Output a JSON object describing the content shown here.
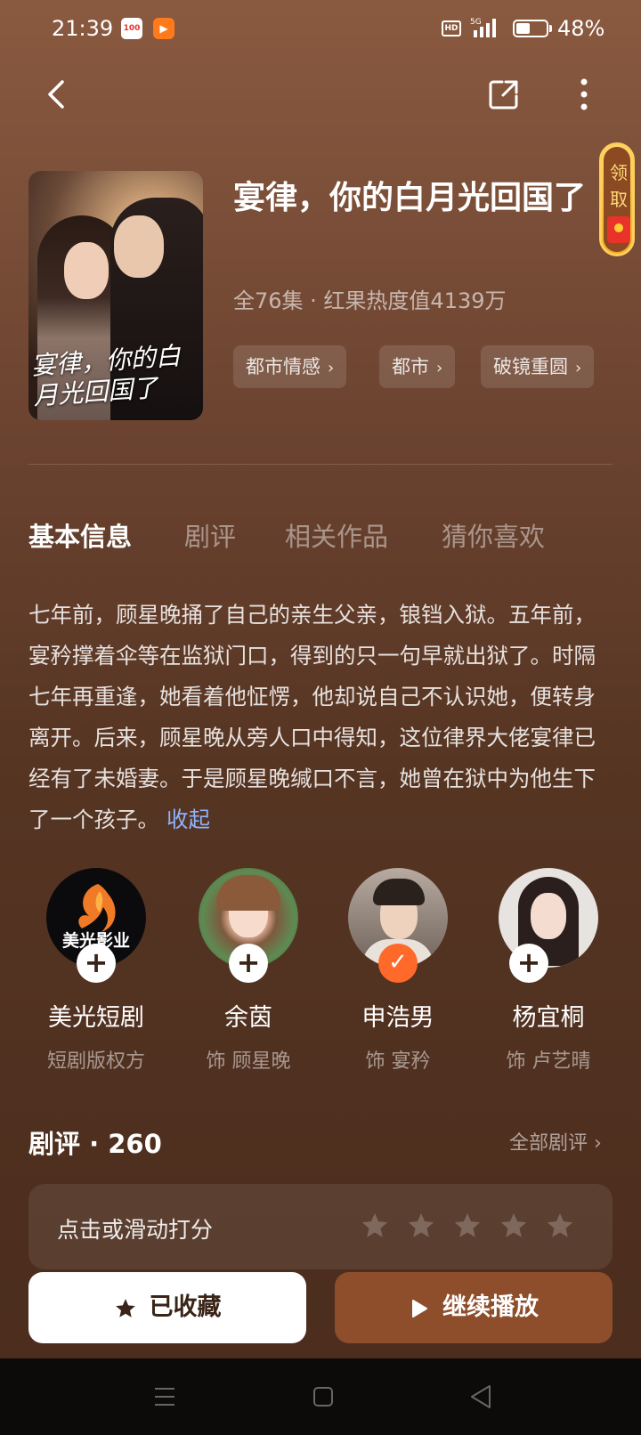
{
  "status_bar": {
    "time": "21:39",
    "app1_label": "100",
    "network": "5G",
    "hd": "HD",
    "battery_level": 0.48,
    "battery_text": "48%"
  },
  "nav": {
    "back_icon": "back-icon",
    "share_icon": "share-icon",
    "more_icon": "more-icon"
  },
  "drama": {
    "title": "宴律，你的白月光回国了",
    "cover_title": "宴律，你的白月光回国了",
    "meta": "全76集 · 红果热度值4139万",
    "tags": [
      "都市情感",
      "都市",
      "破镜重圆"
    ]
  },
  "reward_badge": "领取",
  "tabs": [
    "基本信息",
    "剧评",
    "相关作品",
    "猜你喜欢"
  ],
  "synopsis": {
    "text": "七年前，顾星晚捅了自己的亲生父亲，锒铛入狱。五年前，宴矜撑着伞等在监狱门口，得到的只一句早就出狱了。时隔七年再重逢，她看着他怔愣，他却说自己不认识她，便转身离开。后来，顾星晚从旁人口中得知，这位律界大佬宴律已经有了未婚妻。于是顾星晚缄口不言，她曾在狱中为他生下了一个孩子。",
    "collapse_label": "收起"
  },
  "cast": [
    {
      "name": "美光短剧",
      "role": "短剧版权方",
      "logo_text": "美光影业",
      "followed": false
    },
    {
      "name": "余茵",
      "role": "饰 顾星晚",
      "followed": false
    },
    {
      "name": "申浩男",
      "role": "饰 宴矜",
      "followed": true
    },
    {
      "name": "杨宜桐",
      "role": "饰 卢艺晴",
      "followed": false
    }
  ],
  "reviews": {
    "title": "剧评 · 260",
    "all_label": "全部剧评",
    "rating_hint": "点击或滑动打分",
    "star_count": 5
  },
  "buttons": {
    "favorite": "已收藏",
    "play": "继续播放"
  },
  "colors": {
    "accent_link": "#8fb3ff",
    "play_button": "#8e4e2c",
    "follow_check": "#ff6a2a"
  }
}
